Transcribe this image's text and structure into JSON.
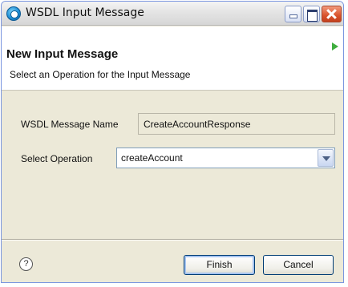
{
  "window": {
    "title": "WSDL Input Message",
    "icon": "eclipse-circle-icon"
  },
  "header": {
    "title": "New Input Message",
    "description": "Select an Operation for the Input Message"
  },
  "form": {
    "message_name_label": "WSDL Message Name",
    "message_name_value": "CreateAccountResponse",
    "operation_label": "Select Operation",
    "operation_value": "createAccount"
  },
  "footer": {
    "help_label": "?",
    "finish_label": "Finish",
    "cancel_label": "Cancel"
  },
  "colors": {
    "frame_border": "#7a96df",
    "dialog_bg": "#ece9d8",
    "close_button": "#d9532c",
    "indicator_arrow": "#3fae3f"
  }
}
